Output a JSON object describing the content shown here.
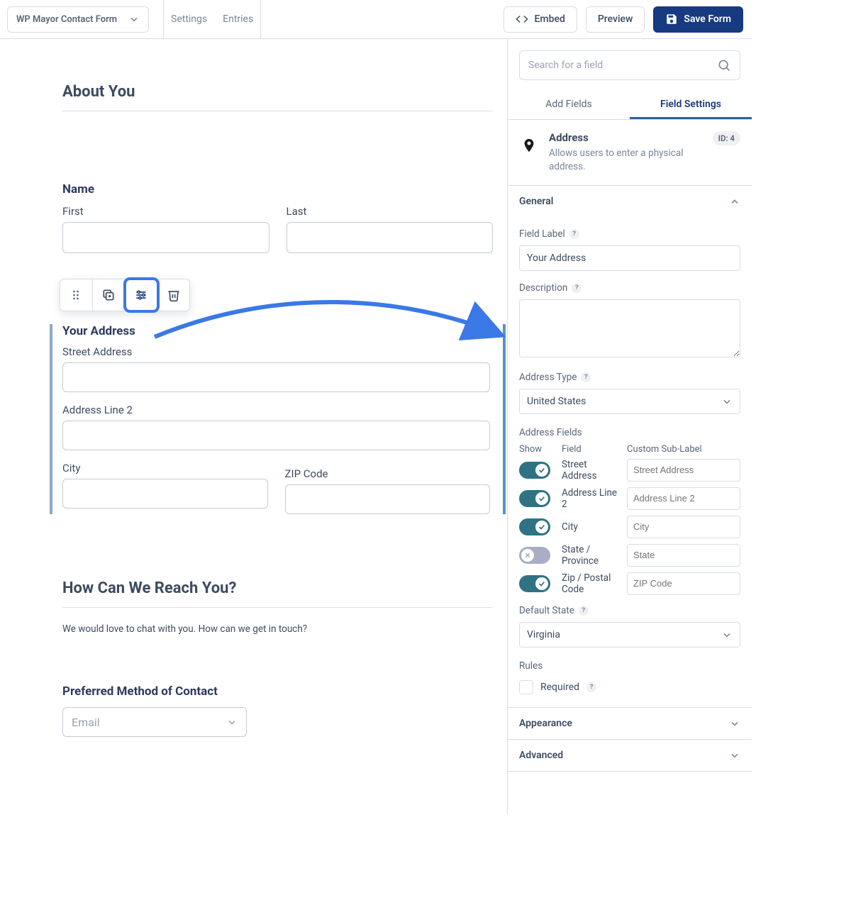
{
  "topbar": {
    "form_name": "WP Mayor Contact Form",
    "settings": "Settings",
    "entries": "Entries",
    "embed": "Embed",
    "preview": "Preview",
    "save": "Save Form"
  },
  "canvas": {
    "about_title": "About You",
    "name_label": "Name",
    "first": "First",
    "last": "Last",
    "address_label": "Your Address",
    "street": "Street Address",
    "line2": "Address Line 2",
    "city": "City",
    "zip": "ZIP Code",
    "how_title": "How Can We Reach You?",
    "how_desc": "We would love to chat with you. How can we get in touch?",
    "preferred_label": "Preferred Method of Contact",
    "preferred_selected": "Email"
  },
  "sidebar": {
    "search_placeholder": "Search for a field",
    "tab_add": "Add Fields",
    "tab_settings": "Field Settings",
    "field_type_title": "Address",
    "field_type_desc": "Allows users to enter a physical address.",
    "id_chip": "ID: 4",
    "general": "General",
    "field_label_label": "Field Label",
    "field_label_value": "Your Address",
    "description_label": "Description",
    "address_type_label": "Address Type",
    "address_type_value": "United States",
    "address_fields_label": "Address Fields",
    "col_show": "Show",
    "col_field": "Field",
    "col_sublabel": "Custom Sub-Label",
    "rows": [
      {
        "on": true,
        "name": "Street Address",
        "placeholder": "Street Address"
      },
      {
        "on": true,
        "name": "Address Line 2",
        "placeholder": "Address Line 2"
      },
      {
        "on": true,
        "name": "City",
        "placeholder": "City"
      },
      {
        "on": false,
        "name": "State / Province",
        "placeholder": "State"
      },
      {
        "on": true,
        "name": "Zip / Postal Code",
        "placeholder": "ZIP Code"
      }
    ],
    "default_state_label": "Default State",
    "default_state_value": "Virginia",
    "rules_label": "Rules",
    "required_label": "Required",
    "appearance": "Appearance",
    "advanced": "Advanced"
  }
}
